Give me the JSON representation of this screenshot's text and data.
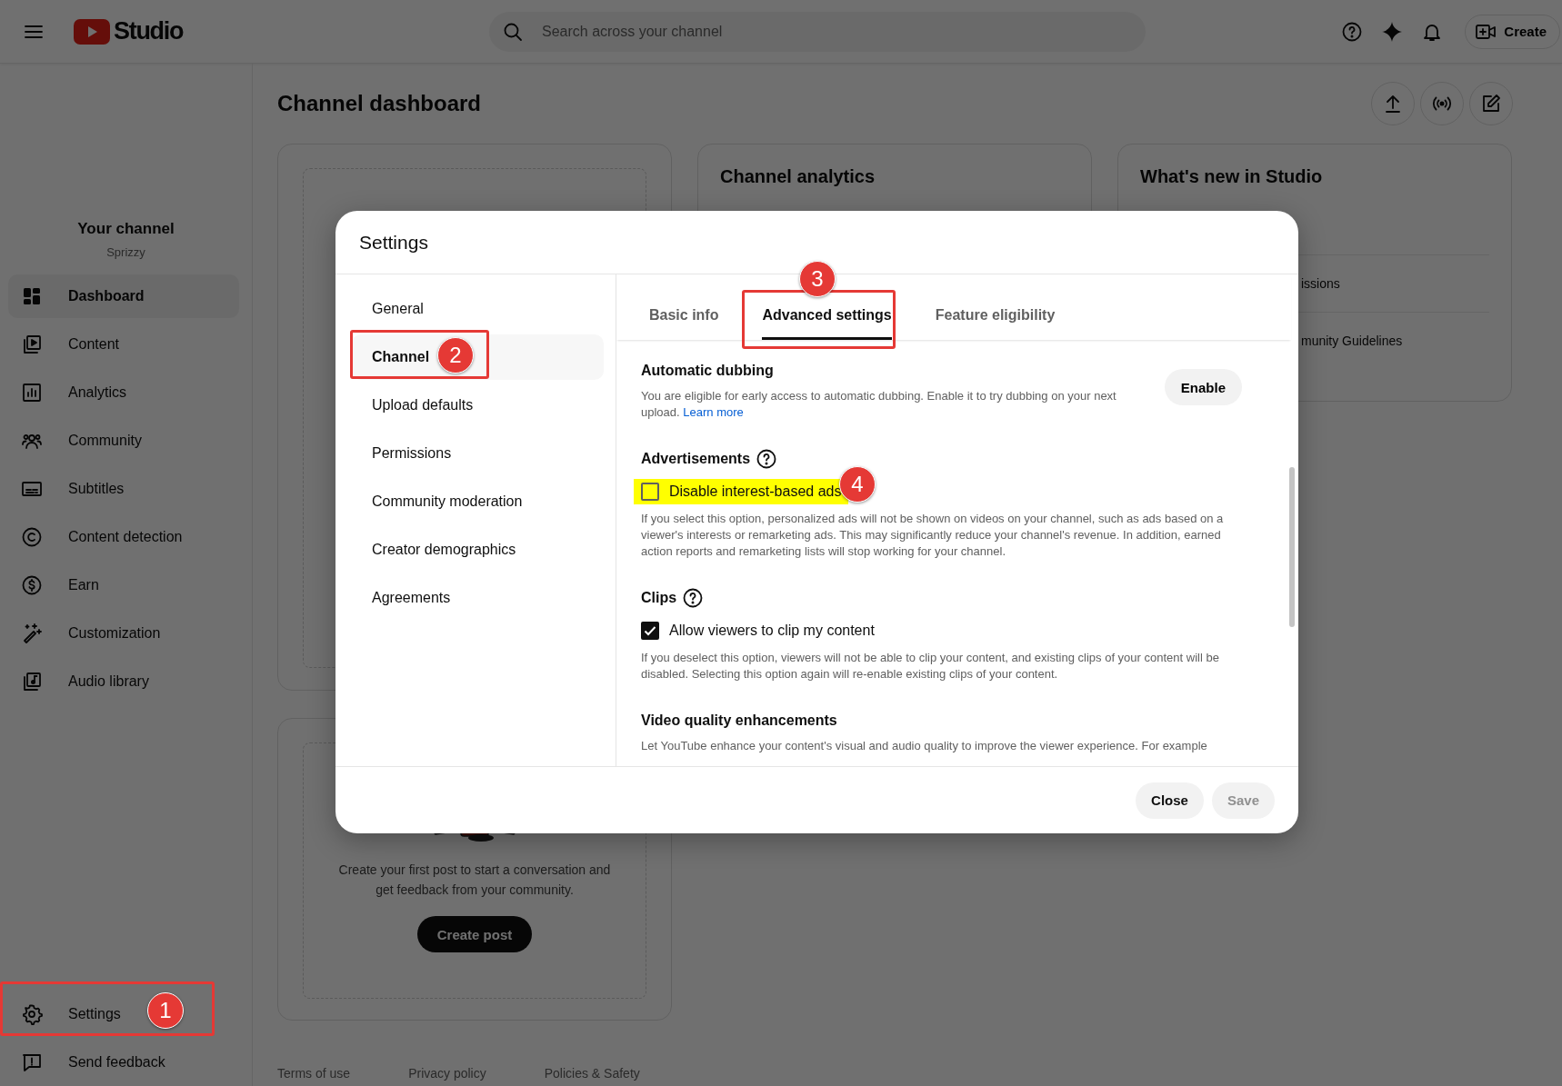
{
  "header": {
    "logo_text": "Studio",
    "search_placeholder": "Search across your channel",
    "create_label": "Create"
  },
  "sidebar": {
    "channel_title": "Your channel",
    "channel_name": "Sprizzy",
    "items": [
      {
        "label": "Dashboard",
        "selected": true
      },
      {
        "label": "Content",
        "selected": false
      },
      {
        "label": "Analytics",
        "selected": false
      },
      {
        "label": "Community",
        "selected": false
      },
      {
        "label": "Subtitles",
        "selected": false
      },
      {
        "label": "Content detection",
        "selected": false
      },
      {
        "label": "Earn",
        "selected": false
      },
      {
        "label": "Customization",
        "selected": false
      },
      {
        "label": "Audio library",
        "selected": false
      }
    ],
    "bottom_items": [
      {
        "label": "Settings",
        "selected": false
      },
      {
        "label": "Send feedback",
        "selected": false
      }
    ]
  },
  "dashboard": {
    "title": "Channel dashboard",
    "analytics_title": "Channel analytics",
    "whats_new": {
      "title": "What's new in Studio",
      "items": [
        "issions",
        "munity Guidelines"
      ]
    },
    "post_card": {
      "text": "Create your first post to start a conversation and get feedback from your community.",
      "button": "Create post"
    },
    "footer_links": [
      "Terms of use",
      "Privacy policy",
      "Policies & Safety"
    ]
  },
  "dialog": {
    "title": "Settings",
    "nav": [
      {
        "label": "General",
        "selected": false
      },
      {
        "label": "Channel",
        "selected": true
      },
      {
        "label": "Upload defaults",
        "selected": false
      },
      {
        "label": "Permissions",
        "selected": false
      },
      {
        "label": "Community moderation",
        "selected": false
      },
      {
        "label": "Creator demographics",
        "selected": false
      },
      {
        "label": "Agreements",
        "selected": false
      }
    ],
    "tabs": [
      {
        "label": "Basic info",
        "selected": false
      },
      {
        "label": "Advanced settings",
        "selected": true
      },
      {
        "label": "Feature eligibility",
        "selected": false
      }
    ],
    "sections": [
      {
        "kind": "action",
        "title": "Automatic dubbing",
        "description": "You are eligible for early access to automatic dubbing. Enable it to try dubbing on your next upload.",
        "link": "Learn more",
        "button": "Enable"
      },
      {
        "kind": "checkbox",
        "title": "Advertisements",
        "option": {
          "label": "Disable interest-based ads",
          "checked": false,
          "highlighted": true
        },
        "description": "If you select this option, personalized ads will not be shown on videos on your channel, such as ads based on a viewer's interests or remarketing ads. This may significantly reduce your channel's revenue. In addition, earned action reports and remarketing lists will stop working for your channel."
      },
      {
        "kind": "checkbox",
        "title": "Clips",
        "option": {
          "label": "Allow viewers to clip my content",
          "checked": true,
          "highlighted": false
        },
        "description": "If you deselect this option, viewers will not be able to clip your content, and existing clips of your content will be disabled. Selecting this option again will re-enable existing clips of your content."
      },
      {
        "kind": "text",
        "title": "Video quality enhancements",
        "description": "Let YouTube enhance your content's visual and audio quality to improve the viewer experience. For example"
      }
    ],
    "buttons": [
      {
        "label": "Close",
        "disabled": false
      },
      {
        "label": "Save",
        "disabled": true
      }
    ]
  },
  "annotations": [
    {
      "number": "1"
    },
    {
      "number": "2"
    },
    {
      "number": "3"
    },
    {
      "number": "4"
    }
  ]
}
